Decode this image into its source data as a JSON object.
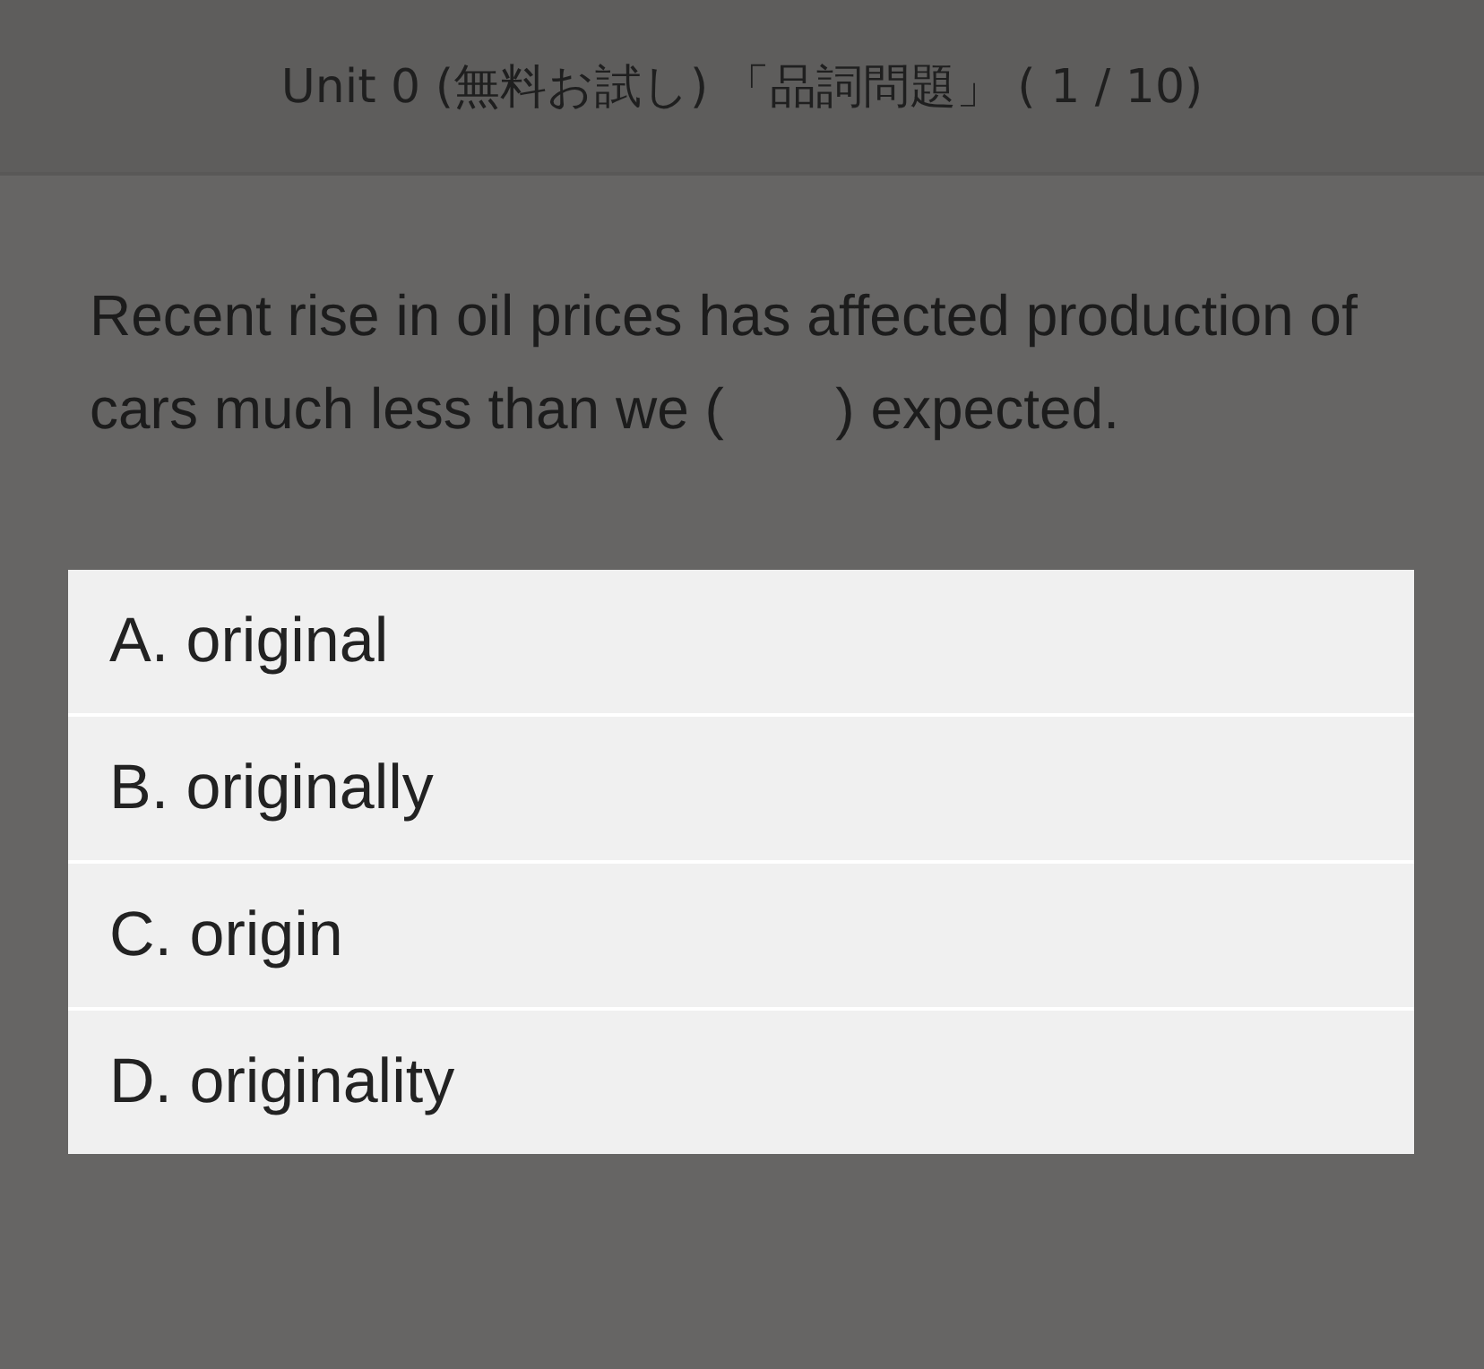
{
  "header": {
    "title": "Unit 0 (無料お試し) 「品詞問題」 ( 1 / 10)"
  },
  "question": "Recent rise in oil prices has affected production of cars much less than we (       ) expected.",
  "options": [
    {
      "label": "A. original",
      "selected": false
    },
    {
      "label": "B. originally",
      "selected": false
    },
    {
      "label": "C. origin",
      "selected": false
    },
    {
      "label": "D. originality",
      "selected": false
    }
  ]
}
